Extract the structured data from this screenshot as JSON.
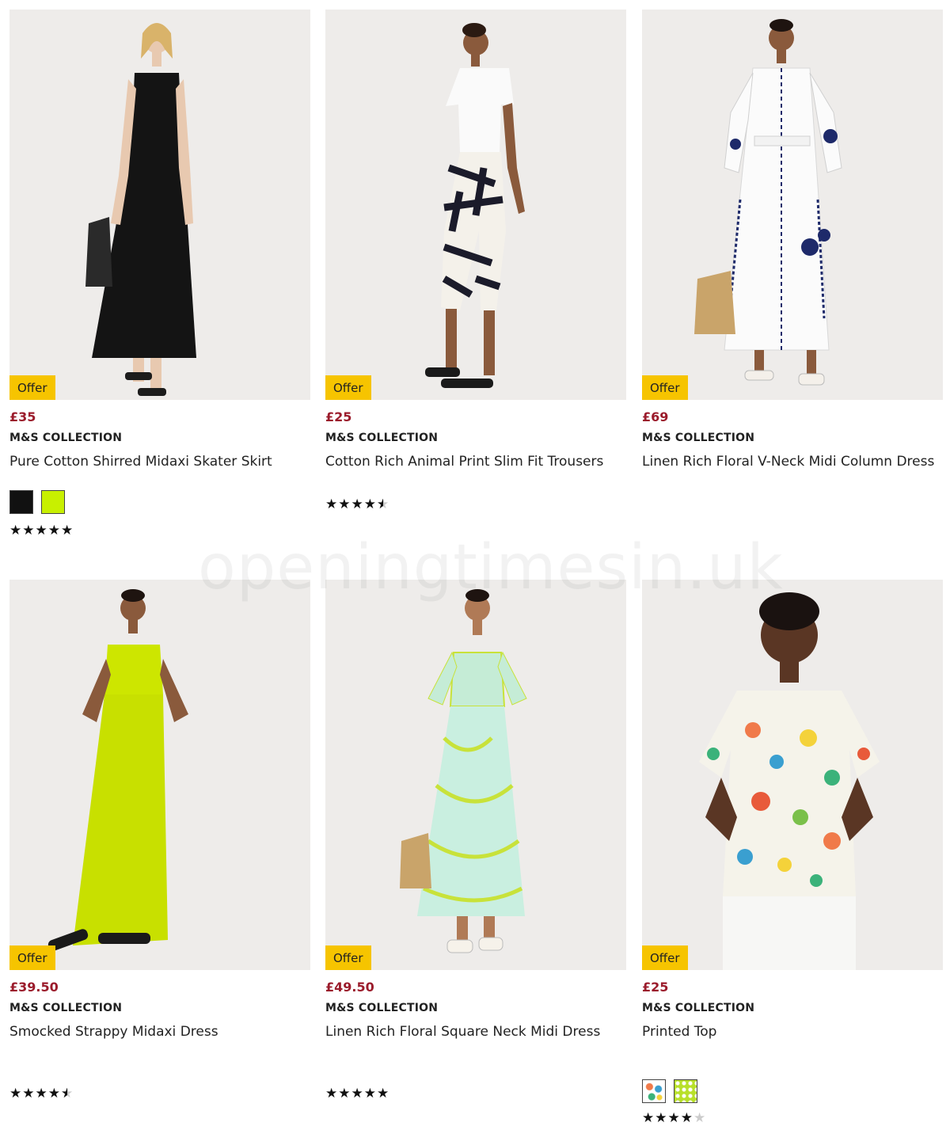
{
  "watermark": "openingtimesin.uk",
  "products": [
    {
      "badge": "Offer",
      "price": "£35",
      "brand": "M&S COLLECTION",
      "title": "Pure Cotton Shirred Midaxi Skater Skirt",
      "swatches": [
        "#111111",
        "#c8f000"
      ],
      "rating": 5
    },
    {
      "badge": "Offer",
      "price": "£25",
      "brand": "M&S COLLECTION",
      "title": "Cotton Rich Animal Print Slim Fit Trousers",
      "swatches": [],
      "rating": 4.5
    },
    {
      "badge": "Offer",
      "price": "£69",
      "brand": "M&S COLLECTION",
      "title": "Linen Rich Floral V-Neck Midi Column Dress",
      "swatches": [],
      "rating": null
    },
    {
      "badge": "Offer",
      "price": "£39.50",
      "brand": "M&S COLLECTION",
      "title": "Smocked Strappy Midaxi Dress",
      "swatches": [],
      "rating": 4.5
    },
    {
      "badge": "Offer",
      "price": "£49.50",
      "brand": "M&S COLLECTION",
      "title": "Linen Rich Floral Square Neck Midi Dress",
      "swatches": [],
      "rating": 5
    },
    {
      "badge": "Offer",
      "price": "£25",
      "brand": "M&S COLLECTION",
      "title": "Printed Top",
      "swatches": [
        "floral-multi",
        "dot-lime"
      ],
      "rating": 4
    }
  ]
}
